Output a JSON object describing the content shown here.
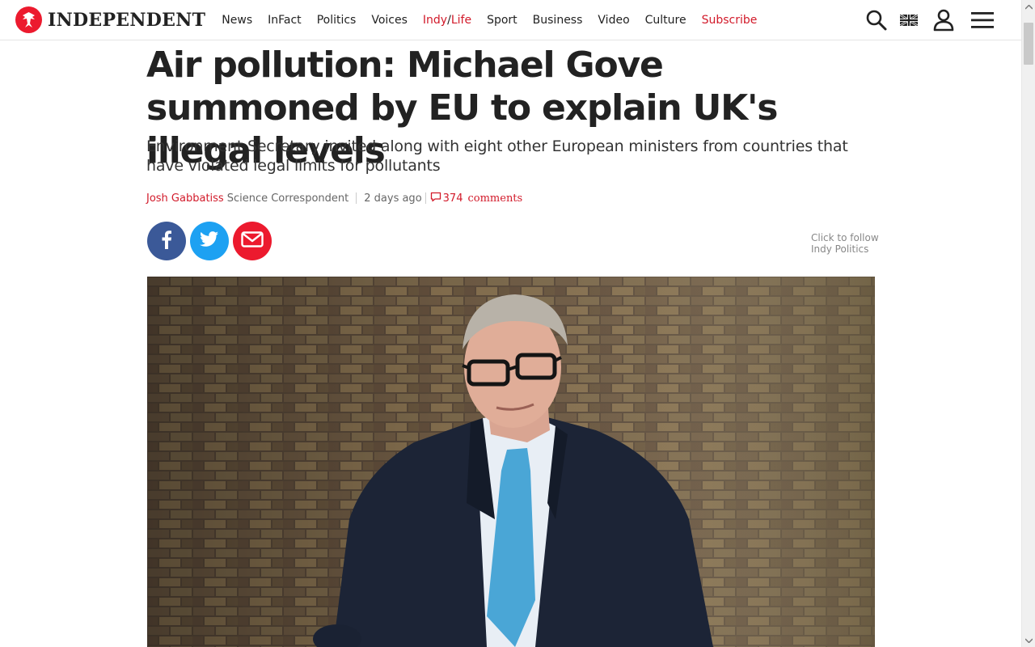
{
  "brand": {
    "name": "INDEPENDENT",
    "color": "#ec1a2e"
  },
  "nav": {
    "items": [
      {
        "label": "News"
      },
      {
        "label": "InFact"
      },
      {
        "label": "Politics"
      },
      {
        "label": "Voices"
      },
      {
        "label_a": "Indy",
        "label_b": "Life"
      },
      {
        "label": "Sport"
      },
      {
        "label": "Business"
      },
      {
        "label": "Video"
      },
      {
        "label": "Culture"
      },
      {
        "label": "Subscribe"
      }
    ]
  },
  "tools": [
    "search-icon",
    "uk-flag-icon",
    "user-icon",
    "menu-icon"
  ],
  "article": {
    "headline": "Air pollution: Michael Gove summoned by EU to explain UK's illegal levels",
    "standfirst": "Environment Secretary invited along with eight other European ministers from countries that have violated legal limits for pollutants",
    "author": "Josh Gabbatiss",
    "role": "Science Correspondent",
    "time": "2 days ago",
    "comment_count": "374",
    "comment_label": "comments",
    "follow_line1": "Click to follow",
    "follow_line2": "Indy Politics"
  },
  "share": [
    "facebook-icon",
    "twitter-icon",
    "email-icon"
  ],
  "colors": {
    "accent": "#d21a2a",
    "facebook": "#3b5998",
    "twitter": "#1da1f2",
    "email": "#ec1a2e"
  }
}
